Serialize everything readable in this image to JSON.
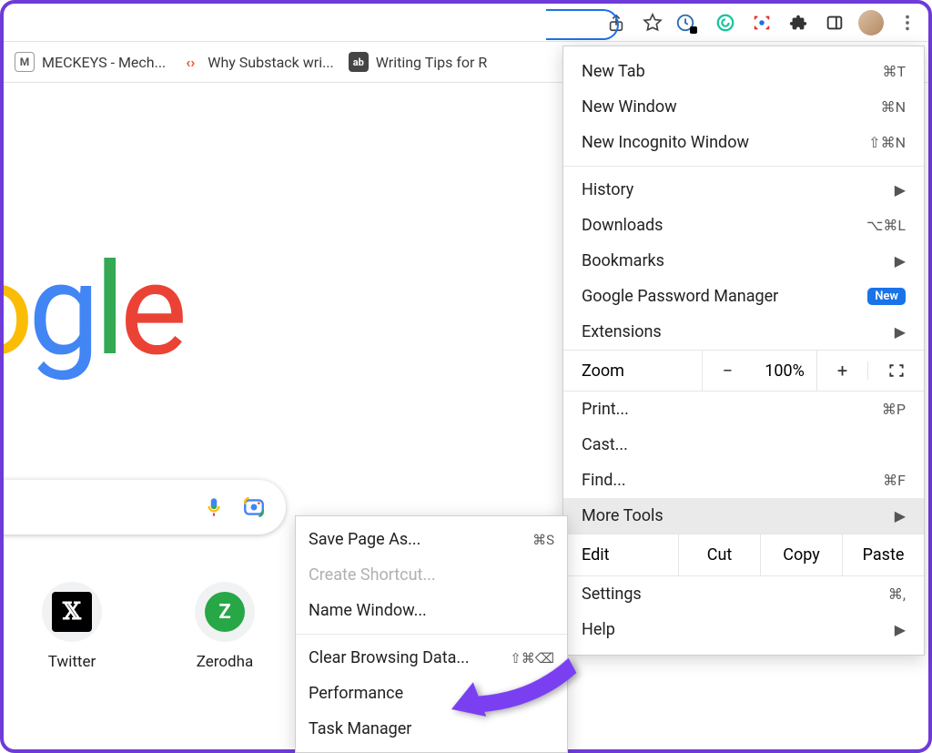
{
  "toolbar": {
    "icons": [
      "share",
      "star",
      "onetab",
      "grammarly",
      "screenshot",
      "extensions",
      "sidepanel",
      "profile",
      "menu"
    ]
  },
  "bookmarks": [
    {
      "label": "MECKEYS - Mech...",
      "favText": "M",
      "favBg": "#fff",
      "favColor": "#555",
      "favBorder": "#999"
    },
    {
      "label": "Why Substack wri...",
      "favText": "‹›",
      "favBg": "#fff",
      "favColor": "#f05a28",
      "favBorder": "transparent"
    },
    {
      "label": "Writing Tips for R",
      "favText": "ab",
      "favBg": "#444",
      "favColor": "#fff",
      "favBorder": "transparent"
    }
  ],
  "shortcuts": [
    {
      "label": "Twitter",
      "kind": "x"
    },
    {
      "label": "Zerodha",
      "kind": "z"
    }
  ],
  "menu": {
    "new_tab": "New Tab",
    "new_tab_sc": "⌘T",
    "new_window": "New Window",
    "new_window_sc": "⌘N",
    "incognito": "New Incognito Window",
    "incognito_sc": "⇧⌘N",
    "history": "History",
    "downloads": "Downloads",
    "downloads_sc": "⌥⌘L",
    "bookmarks": "Bookmarks",
    "password_manager": "Google Password Manager",
    "new_badge": "New",
    "extensions": "Extensions",
    "zoom_label": "Zoom",
    "zoom_value": "100%",
    "print": "Print...",
    "print_sc": "⌘P",
    "cast": "Cast...",
    "find": "Find...",
    "find_sc": "⌘F",
    "more_tools": "More Tools",
    "edit": "Edit",
    "cut": "Cut",
    "copy": "Copy",
    "paste": "Paste",
    "settings": "Settings",
    "settings_sc": "⌘,",
    "help": "Help"
  },
  "submenu": {
    "save_page": "Save Page As...",
    "save_page_sc": "⌘S",
    "create_shortcut": "Create Shortcut...",
    "name_window": "Name Window...",
    "clear_data": "Clear Browsing Data...",
    "clear_data_sc": "⇧⌘⌫",
    "performance": "Performance",
    "task_manager": "Task Manager"
  }
}
